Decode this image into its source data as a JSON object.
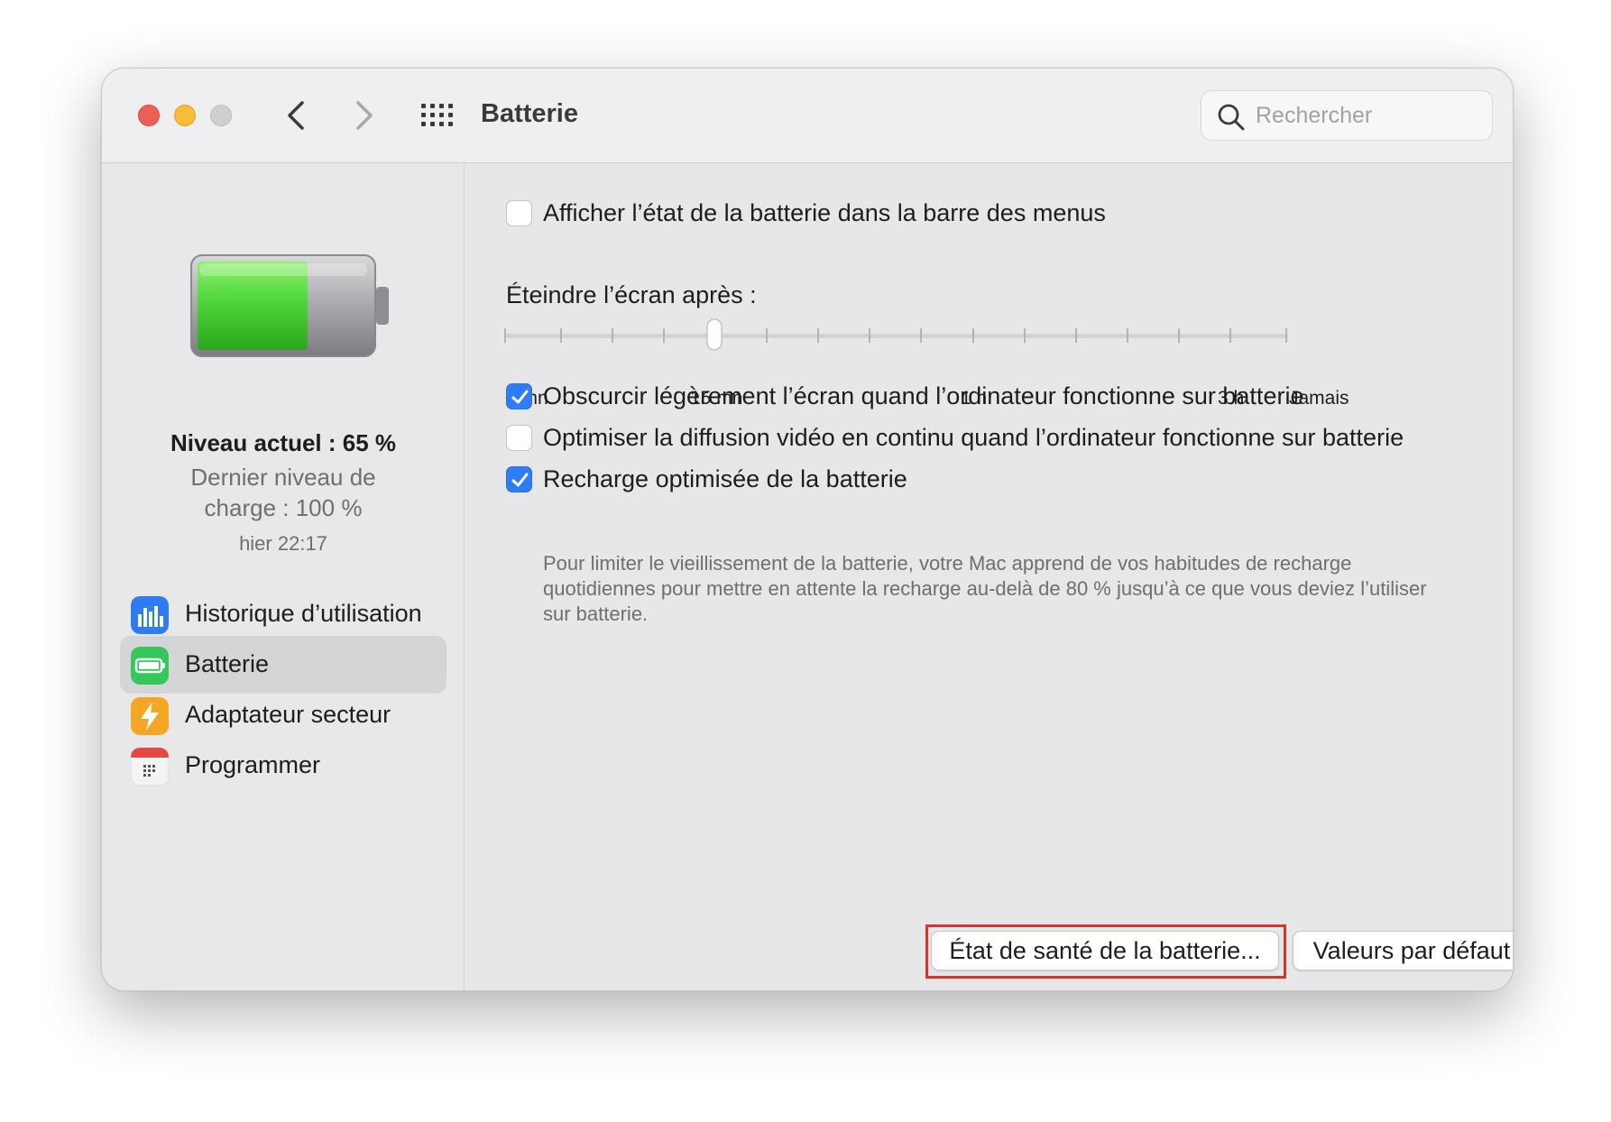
{
  "window": {
    "title": "Batterie",
    "search_placeholder": "Rechercher"
  },
  "icons": {
    "close": "red-circle",
    "minimize": "yellow-circle",
    "zoom": "gray-circle",
    "back": "chevron-left-icon",
    "forward": "chevron-right-icon",
    "grid": "grid-icon",
    "search": "magnifying-glass-icon"
  },
  "sidebar": {
    "battery_fill_fraction": 0.65,
    "level_current": "Niveau actuel : 65 %",
    "level_last": "Dernier niveau de charge : 100 %",
    "level_time": "hier 22:17",
    "items": [
      {
        "label": "Historique d’utilisation",
        "icon": "bar-chart-icon",
        "color": "#2d7cf6",
        "selected": false
      },
      {
        "label": "Batterie",
        "icon": "battery-icon",
        "color": "#34c759",
        "selected": true
      },
      {
        "label": "Adaptateur secteur",
        "icon": "bolt-icon",
        "color": "#f5a623",
        "selected": false
      },
      {
        "label": "Programmer",
        "icon": "calendar-icon",
        "color": "#e5483e",
        "selected": false
      }
    ]
  },
  "settings": {
    "show_in_menu_bar": {
      "label": "Afficher l’état de la batterie dans la barre des menus",
      "checked": false
    },
    "sleep": {
      "label": "Éteindre l’écran après :",
      "ticks": [
        "1 mn",
        "15 mn",
        "1 h",
        "3 h",
        "Jamais"
      ],
      "value": "15 mn"
    },
    "dim_display": {
      "label": "Obscurcir légèrement l’écran quand l’ordinateur fonctionne sur batterie",
      "checked": true
    },
    "optimize_video": {
      "label": "Optimiser la diffusion vidéo en continu quand l’ordinateur fonctionne sur batterie",
      "checked": false
    },
    "optimized_charging": {
      "label": "Recharge optimisée de la batterie",
      "checked": true,
      "description": "Pour limiter le vieillissement de la batterie, votre Mac apprend de vos habitudes de recharge quotidiennes pour mettre en attente la recharge au-delà de 80 % jusqu’à ce que vous deviez l’utiliser sur batterie."
    }
  },
  "buttons": {
    "health": "État de santé de la batterie...",
    "defaults": "Valeurs par défaut",
    "help": "?"
  },
  "colors": {
    "accent": "#2f7cf6",
    "highlight": "#d9342b"
  }
}
